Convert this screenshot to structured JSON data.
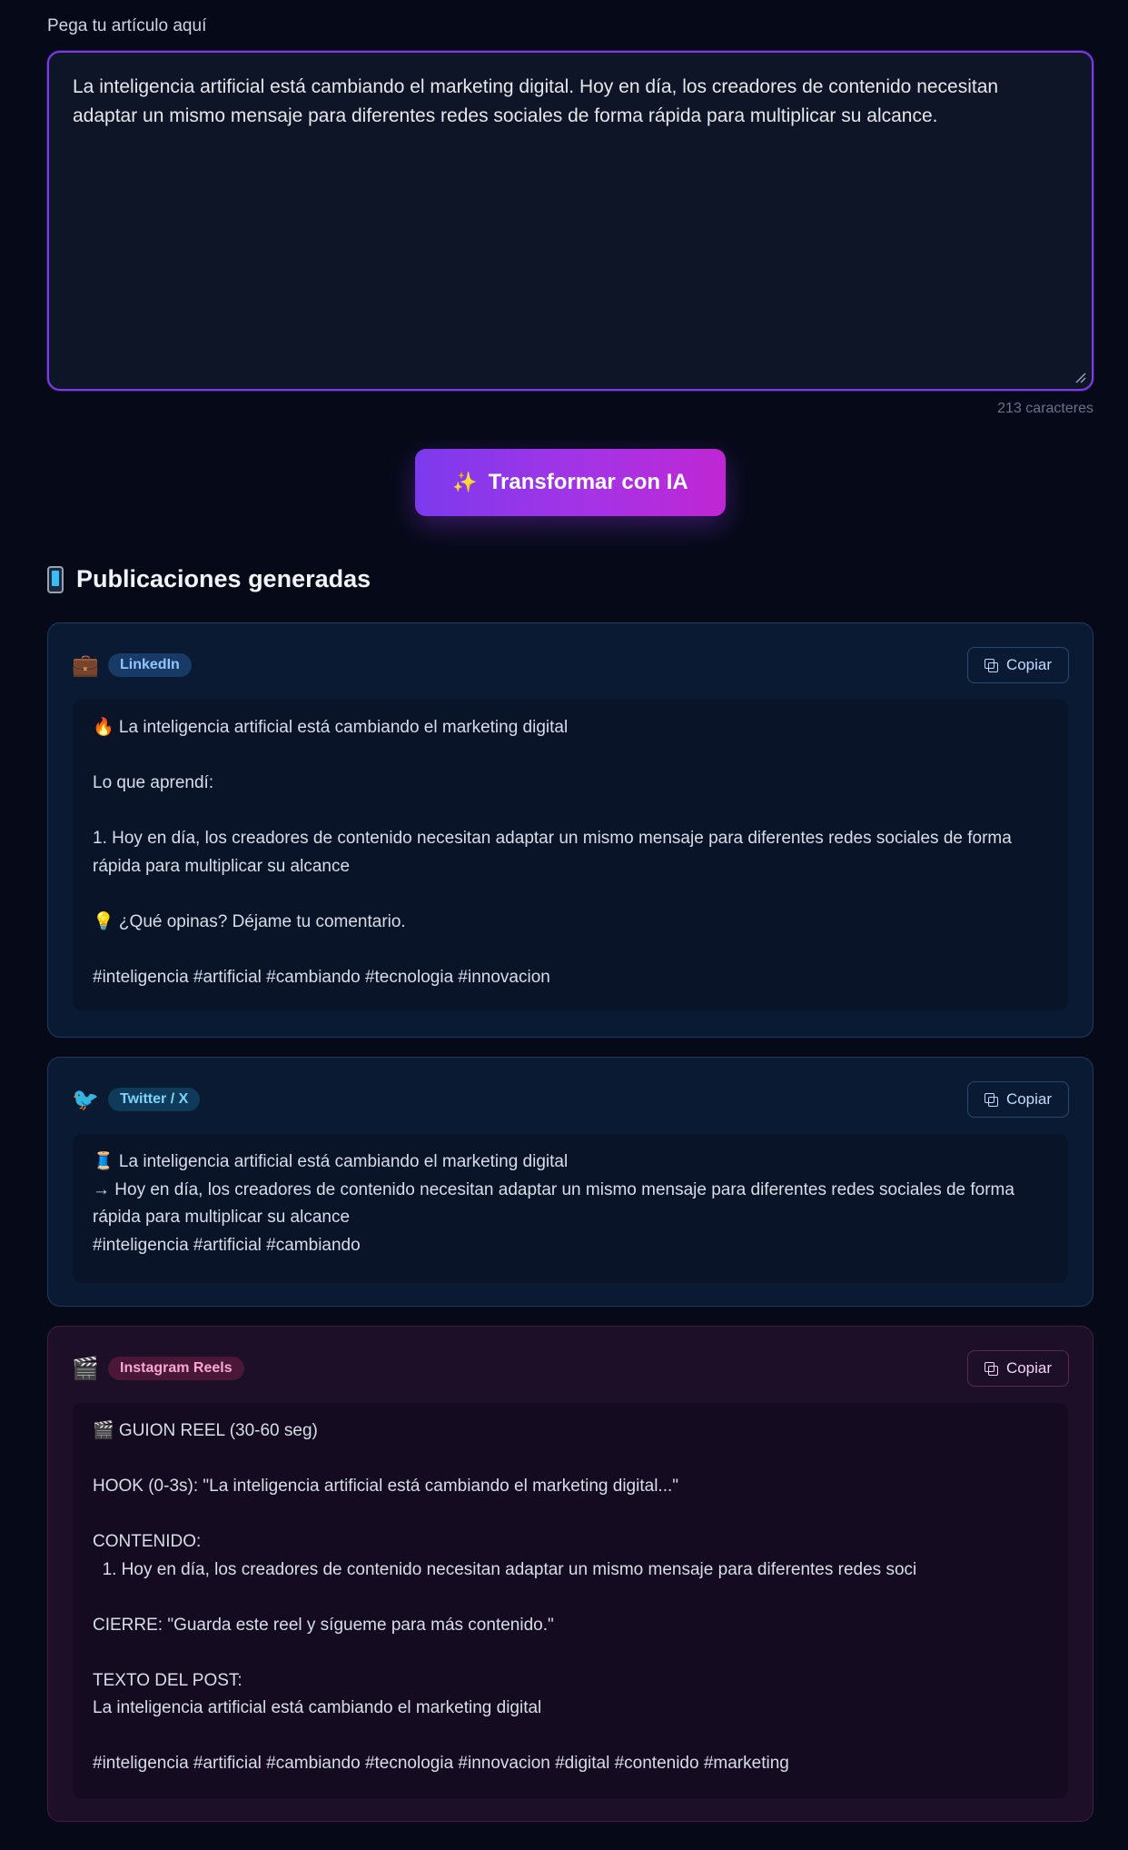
{
  "input": {
    "label": "Pega tu artículo aquí",
    "value": "La inteligencia artificial está cambiando el marketing digital. Hoy en día, los creadores de contenido necesitan adaptar un mismo mensaje para diferentes redes sociales de forma rápida para multiplicar su alcance.",
    "char_count": "213 caracteres"
  },
  "transform_button": {
    "icon": "✨",
    "label": "Transformar con IA"
  },
  "results": {
    "title": "Publicaciones generadas",
    "copy_label": "Copiar",
    "cards": [
      {
        "platform": "LinkedIn",
        "icon": "💼",
        "text": "🔥 La inteligencia artificial está cambiando el marketing digital\n\nLo que aprendí:\n\n1. Hoy en día, los creadores de contenido necesitan adaptar un mismo mensaje para diferentes redes sociales de forma rápida para multiplicar su alcance\n\n💡 ¿Qué opinas? Déjame tu comentario.\n\n#inteligencia #artificial #cambiando #tecnologia #innovacion"
      },
      {
        "platform": "Twitter / X",
        "icon": "🐦",
        "text": "🧵 La inteligencia artificial está cambiando el marketing digital\n→ Hoy en día, los creadores de contenido necesitan adaptar un mismo mensaje para diferentes redes sociales de forma rápida para multiplicar su alcance\n#inteligencia #artificial #cambiando"
      },
      {
        "platform": "Instagram Reels",
        "icon": "🎬",
        "text": "🎬 GUION REEL (30-60 seg)\n\nHOOK (0-3s): \"La inteligencia artificial está cambiando el marketing digital...\"\n\nCONTENIDO:\n  1. Hoy en día, los creadores de contenido necesitan adaptar un mismo mensaje para diferentes redes soci\n\nCIERRE: \"Guarda este reel y sígueme para más contenido.\"\n\nTEXTO DEL POST:\nLa inteligencia artificial está cambiando el marketing digital\n\n#inteligencia #artificial #cambiando #tecnologia #innovacion #digital #contenido #marketing"
      }
    ]
  },
  "colors": {
    "background": "#060a18",
    "accent_start": "#7c3aed",
    "accent_end": "#c026d3"
  }
}
